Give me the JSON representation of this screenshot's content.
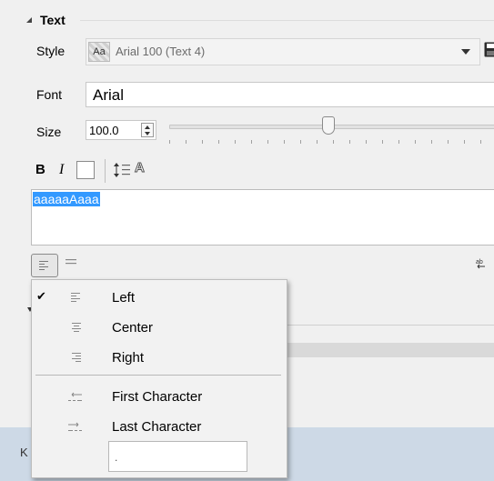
{
  "section": {
    "title": "Text"
  },
  "style": {
    "label": "Style",
    "value": "Arial 100 (Text 4)",
    "swatch_text": "Aa"
  },
  "font": {
    "label": "Font",
    "value": "Arial"
  },
  "size": {
    "label": "Size",
    "value": "100.0",
    "slider_fraction": 0.49
  },
  "toolbar": {
    "bold": "B",
    "italic": "I",
    "outline": "A"
  },
  "text_content": {
    "value": "aaaaaAaaa"
  },
  "alignment_menu": {
    "items": [
      {
        "label": "Left",
        "checked": true,
        "icon": "align-left-icon"
      },
      {
        "label": "Center",
        "checked": false,
        "icon": "align-center-icon"
      },
      {
        "label": "Right",
        "checked": false,
        "icon": "align-right-icon"
      },
      {
        "label": "First Character",
        "checked": false,
        "icon": "align-first-character-icon"
      },
      {
        "label": "Last Character",
        "checked": false,
        "icon": "align-last-character-icon"
      }
    ],
    "character_value": ".",
    "check_mark": "✔"
  },
  "bottom": {
    "text": "K"
  },
  "colors": {
    "selection": "#3399ff",
    "bottom_strip": "#cdd9e6",
    "panel": "#f0f0f0"
  }
}
